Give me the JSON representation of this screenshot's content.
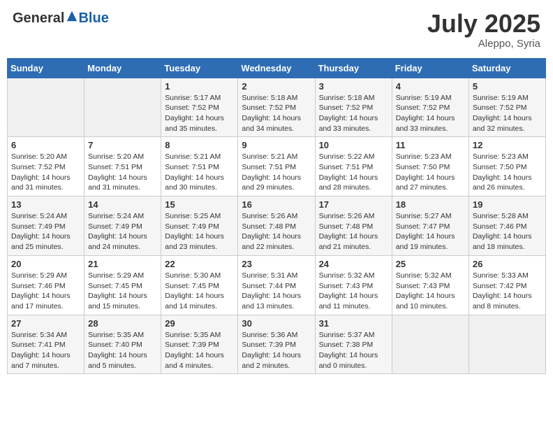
{
  "header": {
    "logo_general": "General",
    "logo_blue": "Blue",
    "month_year": "July 2025",
    "location": "Aleppo, Syria"
  },
  "weekdays": [
    "Sunday",
    "Monday",
    "Tuesday",
    "Wednesday",
    "Thursday",
    "Friday",
    "Saturday"
  ],
  "weeks": [
    [
      {
        "day": "",
        "info": ""
      },
      {
        "day": "",
        "info": ""
      },
      {
        "day": "1",
        "info": "Sunrise: 5:17 AM\nSunset: 7:52 PM\nDaylight: 14 hours\nand 35 minutes."
      },
      {
        "day": "2",
        "info": "Sunrise: 5:18 AM\nSunset: 7:52 PM\nDaylight: 14 hours\nand 34 minutes."
      },
      {
        "day": "3",
        "info": "Sunrise: 5:18 AM\nSunset: 7:52 PM\nDaylight: 14 hours\nand 33 minutes."
      },
      {
        "day": "4",
        "info": "Sunrise: 5:19 AM\nSunset: 7:52 PM\nDaylight: 14 hours\nand 33 minutes."
      },
      {
        "day": "5",
        "info": "Sunrise: 5:19 AM\nSunset: 7:52 PM\nDaylight: 14 hours\nand 32 minutes."
      }
    ],
    [
      {
        "day": "6",
        "info": "Sunrise: 5:20 AM\nSunset: 7:52 PM\nDaylight: 14 hours\nand 31 minutes."
      },
      {
        "day": "7",
        "info": "Sunrise: 5:20 AM\nSunset: 7:51 PM\nDaylight: 14 hours\nand 31 minutes."
      },
      {
        "day": "8",
        "info": "Sunrise: 5:21 AM\nSunset: 7:51 PM\nDaylight: 14 hours\nand 30 minutes."
      },
      {
        "day": "9",
        "info": "Sunrise: 5:21 AM\nSunset: 7:51 PM\nDaylight: 14 hours\nand 29 minutes."
      },
      {
        "day": "10",
        "info": "Sunrise: 5:22 AM\nSunset: 7:51 PM\nDaylight: 14 hours\nand 28 minutes."
      },
      {
        "day": "11",
        "info": "Sunrise: 5:23 AM\nSunset: 7:50 PM\nDaylight: 14 hours\nand 27 minutes."
      },
      {
        "day": "12",
        "info": "Sunrise: 5:23 AM\nSunset: 7:50 PM\nDaylight: 14 hours\nand 26 minutes."
      }
    ],
    [
      {
        "day": "13",
        "info": "Sunrise: 5:24 AM\nSunset: 7:49 PM\nDaylight: 14 hours\nand 25 minutes."
      },
      {
        "day": "14",
        "info": "Sunrise: 5:24 AM\nSunset: 7:49 PM\nDaylight: 14 hours\nand 24 minutes."
      },
      {
        "day": "15",
        "info": "Sunrise: 5:25 AM\nSunset: 7:49 PM\nDaylight: 14 hours\nand 23 minutes."
      },
      {
        "day": "16",
        "info": "Sunrise: 5:26 AM\nSunset: 7:48 PM\nDaylight: 14 hours\nand 22 minutes."
      },
      {
        "day": "17",
        "info": "Sunrise: 5:26 AM\nSunset: 7:48 PM\nDaylight: 14 hours\nand 21 minutes."
      },
      {
        "day": "18",
        "info": "Sunrise: 5:27 AM\nSunset: 7:47 PM\nDaylight: 14 hours\nand 19 minutes."
      },
      {
        "day": "19",
        "info": "Sunrise: 5:28 AM\nSunset: 7:46 PM\nDaylight: 14 hours\nand 18 minutes."
      }
    ],
    [
      {
        "day": "20",
        "info": "Sunrise: 5:29 AM\nSunset: 7:46 PM\nDaylight: 14 hours\nand 17 minutes."
      },
      {
        "day": "21",
        "info": "Sunrise: 5:29 AM\nSunset: 7:45 PM\nDaylight: 14 hours\nand 15 minutes."
      },
      {
        "day": "22",
        "info": "Sunrise: 5:30 AM\nSunset: 7:45 PM\nDaylight: 14 hours\nand 14 minutes."
      },
      {
        "day": "23",
        "info": "Sunrise: 5:31 AM\nSunset: 7:44 PM\nDaylight: 14 hours\nand 13 minutes."
      },
      {
        "day": "24",
        "info": "Sunrise: 5:32 AM\nSunset: 7:43 PM\nDaylight: 14 hours\nand 11 minutes."
      },
      {
        "day": "25",
        "info": "Sunrise: 5:32 AM\nSunset: 7:43 PM\nDaylight: 14 hours\nand 10 minutes."
      },
      {
        "day": "26",
        "info": "Sunrise: 5:33 AM\nSunset: 7:42 PM\nDaylight: 14 hours\nand 8 minutes."
      }
    ],
    [
      {
        "day": "27",
        "info": "Sunrise: 5:34 AM\nSunset: 7:41 PM\nDaylight: 14 hours\nand 7 minutes."
      },
      {
        "day": "28",
        "info": "Sunrise: 5:35 AM\nSunset: 7:40 PM\nDaylight: 14 hours\nand 5 minutes."
      },
      {
        "day": "29",
        "info": "Sunrise: 5:35 AM\nSunset: 7:39 PM\nDaylight: 14 hours\nand 4 minutes."
      },
      {
        "day": "30",
        "info": "Sunrise: 5:36 AM\nSunset: 7:39 PM\nDaylight: 14 hours\nand 2 minutes."
      },
      {
        "day": "31",
        "info": "Sunrise: 5:37 AM\nSunset: 7:38 PM\nDaylight: 14 hours\nand 0 minutes."
      },
      {
        "day": "",
        "info": ""
      },
      {
        "day": "",
        "info": ""
      }
    ]
  ]
}
